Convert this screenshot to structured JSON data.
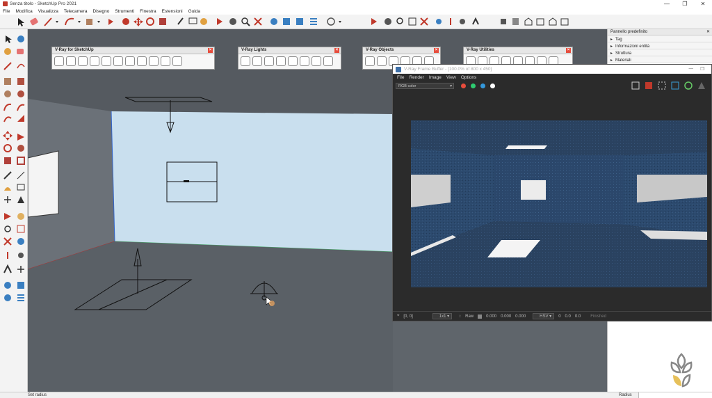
{
  "window": {
    "title": "Senza titolo - SketchUp Pro 2021",
    "minimize_glyph": "—",
    "restore_glyph": "❐",
    "close_glyph": "✕"
  },
  "menu": [
    "File",
    "Modifica",
    "Visualizza",
    "Telecamera",
    "Disegno",
    "Strumenti",
    "Finestra",
    "Estensioni",
    "Guida"
  ],
  "vray_toolbars": {
    "main": {
      "title": "V-Ray for SketchUp",
      "icon_count": 11
    },
    "lights": {
      "title": "V-Ray Lights",
      "icon_count": 8
    },
    "objects": {
      "title": "V-Ray Objects",
      "icon_count": 6
    },
    "utilities": {
      "title": "V-Ray Utilities",
      "icon_count": 8
    },
    "close_glyph": "×"
  },
  "right_panel": {
    "header": "Pannello predefinito",
    "items": [
      "Tag",
      "Informazioni entità",
      "Struttura",
      "Materiali"
    ]
  },
  "frame_buffer": {
    "title": "V-Ray Frame Buffer - [100.0% of 800 x 450]",
    "menu": [
      "File",
      "Render",
      "Image",
      "View",
      "Options"
    ],
    "channel": "RGB color",
    "status": {
      "coords": "[0, 0]",
      "ratio": "1x1",
      "mode": "Raw",
      "r": "0.000",
      "g": "0.000",
      "b": "0.000",
      "color_space": "HSV",
      "h": "0",
      "s": "0.0",
      "v": "0.0",
      "state": "Finished"
    },
    "channel_colors": [
      "#e74c3c",
      "#2ecc71",
      "#3498db",
      "#ffffff"
    ]
  },
  "status_bar": {
    "text": "Set radius",
    "radius_label": "Radius"
  }
}
